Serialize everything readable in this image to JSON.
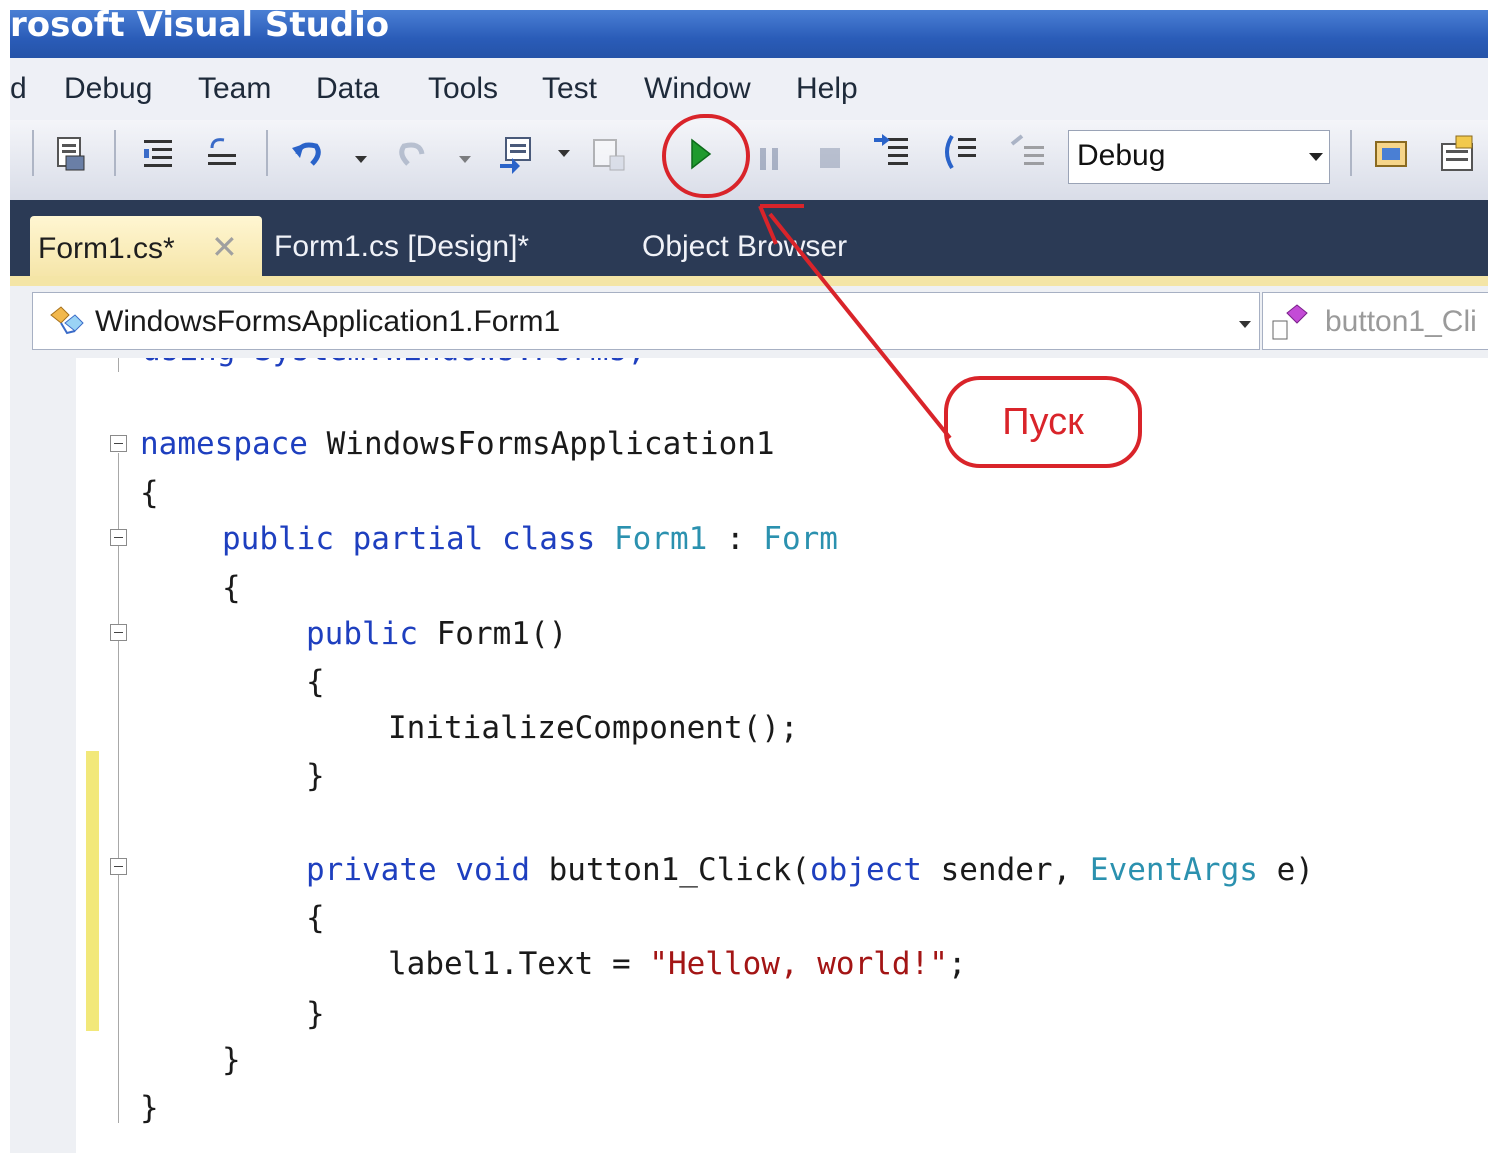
{
  "window": {
    "title": "rosoft Visual Studio"
  },
  "menu": {
    "items": [
      "d",
      "Debug",
      "Team",
      "Data",
      "Tools",
      "Test",
      "Window",
      "Help"
    ]
  },
  "toolbar": {
    "configuration": "Debug",
    "icons": [
      "save-all-icon",
      "indent-icon",
      "outdent-icon",
      "undo-icon",
      "redo-icon",
      "navigate-icon",
      "find-icon",
      "start-debugging-icon",
      "break-all-icon",
      "stop-icon",
      "step-into-icon",
      "step-over-icon",
      "step-out-icon",
      "solution-explorer-icon",
      "properties-icon"
    ]
  },
  "tabs": [
    {
      "label": "Form1.cs*",
      "active": true,
      "close": "✕"
    },
    {
      "label": "Form1.cs [Design]*",
      "active": false
    },
    {
      "label": "Object Browser",
      "active": false
    }
  ],
  "navbar": {
    "type_combo": "WindowsFormsApplication1.Form1",
    "member_combo": "button1_Cli"
  },
  "code": {
    "line_using": "using System.Windows.Forms;",
    "ns_kw": "namespace",
    "ns_name": " WindowsFormsApplication1",
    "brace_open": "{",
    "brace_close": "}",
    "class_kw": "public partial class",
    "class_name": "Form1",
    "class_colon": " : ",
    "class_base": "Form",
    "ctor_kw": "public",
    "ctor_name": " Form1()",
    "init_call": "InitializeComponent();",
    "method_kw1": "private",
    "method_kw2": "void",
    "method_name": " button1_Click(",
    "param_kw": "object",
    "param_sender": " sender, ",
    "param_type": "EventArgs",
    "param_e": " e)",
    "assign_left": "label1.Text = ",
    "assign_str": "\"Hellow, world!\"",
    "assign_end": ";"
  },
  "annotation": {
    "label": "Пуск",
    "color": "#d9242a"
  }
}
